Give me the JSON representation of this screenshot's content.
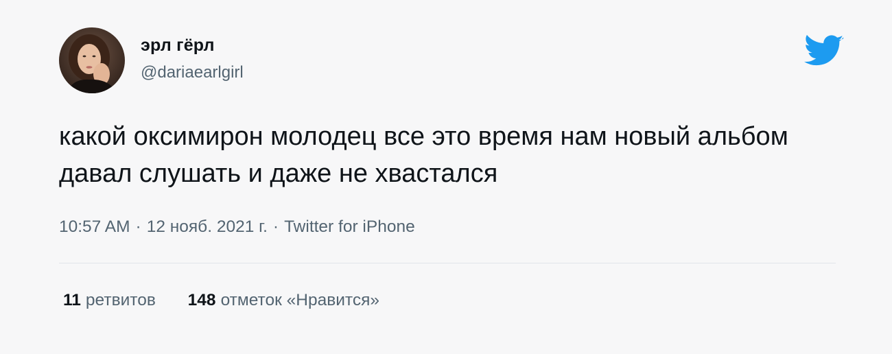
{
  "author": {
    "display_name": "эрл гёрл",
    "handle": "@dariaearlgirl",
    "avatar_icon": "profile-photo"
  },
  "brand": {
    "icon": "twitter-bird-icon",
    "color": "#1d9bf0"
  },
  "tweet": {
    "text": "какой оксимирон молодец все это время нам новый альбом давал слушать и даже не хвастался",
    "time": "10:57 AM",
    "date": "12 нояб. 2021 г.",
    "source": "Twitter for iPhone",
    "separator": "·"
  },
  "stats": {
    "retweets_count": "11",
    "retweets_label": "ретвитов",
    "likes_count": "148",
    "likes_label": "отметок «Нравится»"
  },
  "colors": {
    "background": "#f7f7f8",
    "text_primary": "#0f1419",
    "text_secondary": "#536471",
    "divider": "#e1e5e9"
  }
}
